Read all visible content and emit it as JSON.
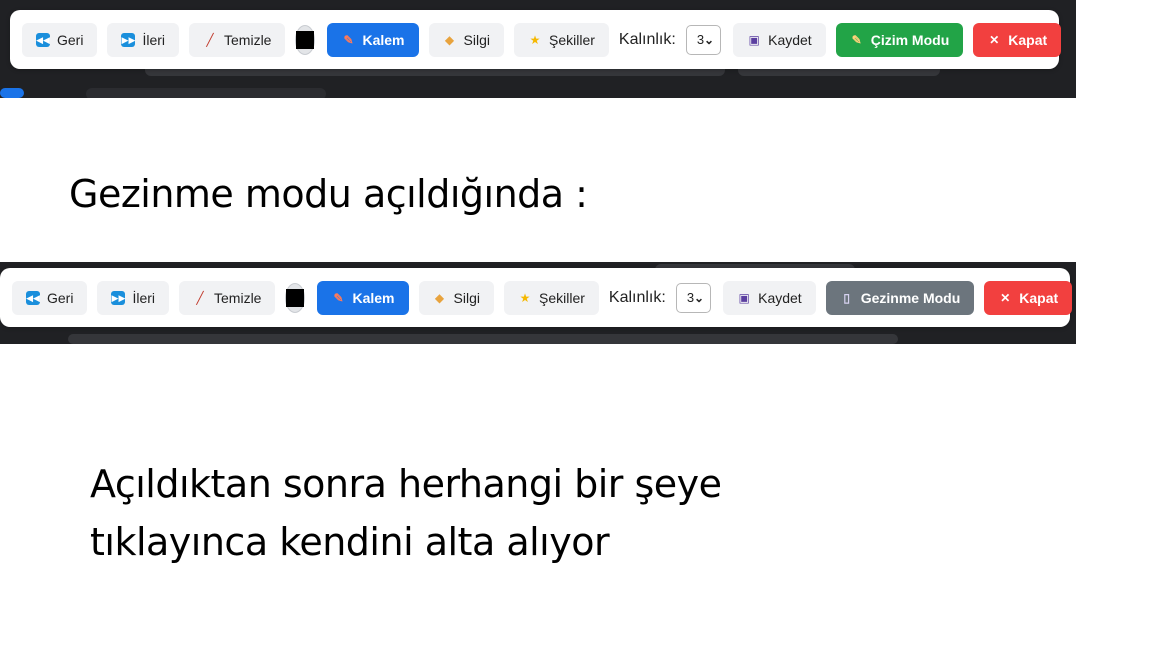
{
  "toolbar_drawing": {
    "back": "Geri",
    "forward": "İleri",
    "clear": "Temizle",
    "pen": "Kalem",
    "eraser": "Silgi",
    "shapes": "Şekiller",
    "thickness_label": "Kalınlık:",
    "thickness_value": "3",
    "save": "Kaydet",
    "mode": "Çizim Modu",
    "close": "Kapat",
    "color": "#000000"
  },
  "caption_1": "Gezinme modu açıldığında :",
  "toolbar_browse": {
    "back": "Geri",
    "forward": "İleri",
    "clear": "Temizle",
    "pen": "Kalem",
    "eraser": "Silgi",
    "shapes": "Şekiller",
    "thickness_label": "Kalınlık:",
    "thickness_value": "3",
    "save": "Kaydet",
    "mode": "Gezinme Modu",
    "close": "Kapat",
    "color": "#000000"
  },
  "caption_2": {
    "line1": "Açıldıktan sonra herhangi bir şeye",
    "line2": "tıklayınca kendini alta alıyor"
  },
  "colors": {
    "primary": "#1a73e8",
    "success": "#22a447",
    "grey": "#6c757d",
    "danger": "#f2403f"
  }
}
